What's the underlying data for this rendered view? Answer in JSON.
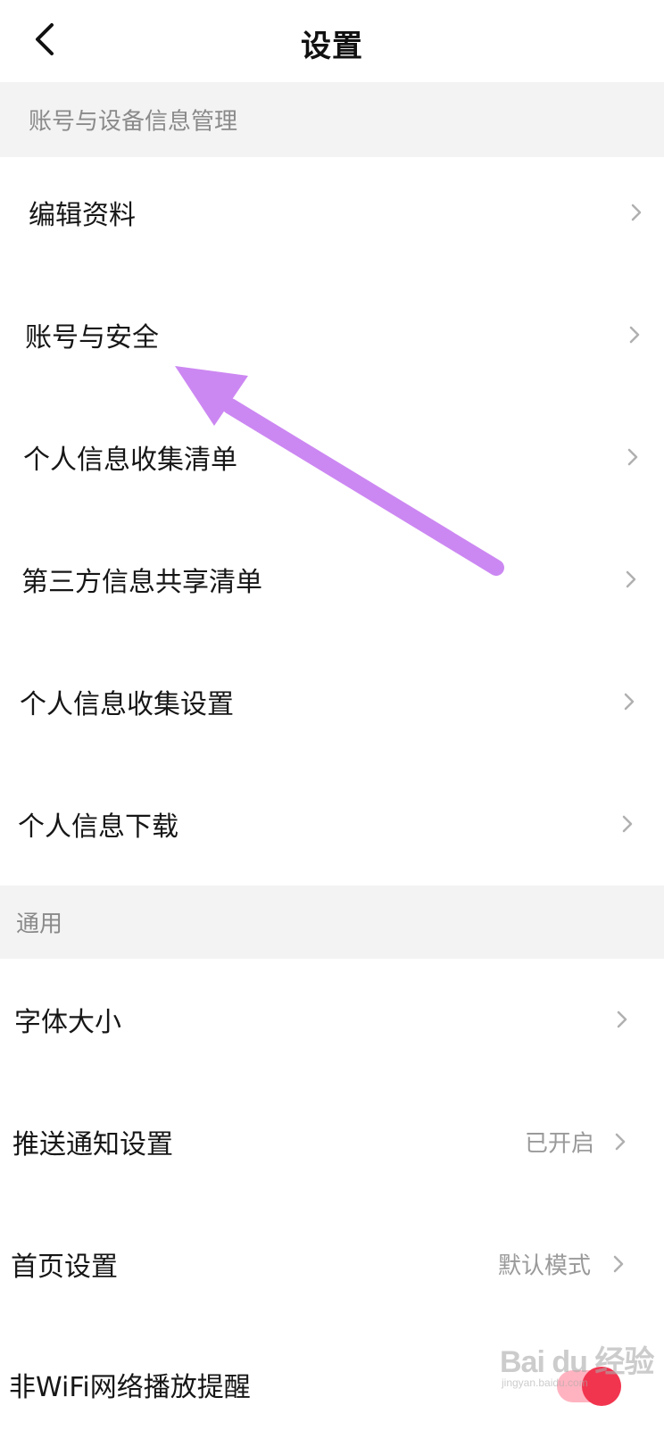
{
  "header": {
    "title": "设置"
  },
  "sections": [
    {
      "title": "账号与设备信息管理",
      "items": [
        {
          "label": "编辑资料"
        },
        {
          "label": "账号与安全"
        },
        {
          "label": "个人信息收集清单"
        },
        {
          "label": "第三方信息共享清单"
        },
        {
          "label": "个人信息收集设置"
        },
        {
          "label": "个人信息下载"
        }
      ]
    },
    {
      "title": "通用",
      "items": [
        {
          "label": "字体大小"
        },
        {
          "label": "推送通知设置",
          "value": "已开启"
        },
        {
          "label": "首页设置",
          "value": "默认模式"
        },
        {
          "label": "非WiFi网络播放提醒",
          "toggle": true
        }
      ]
    }
  ],
  "annotation": {
    "arrow_color": "#cc88f2"
  },
  "watermark": {
    "brand": "Bai du 经验",
    "site": "jingyan.baidu.com"
  },
  "colors": {
    "section_bg": "#f3f3f3",
    "toggle_on": "#f2354f"
  },
  "icons": {
    "back": "back-arrow-icon",
    "chevron": "chevron-right-icon"
  }
}
